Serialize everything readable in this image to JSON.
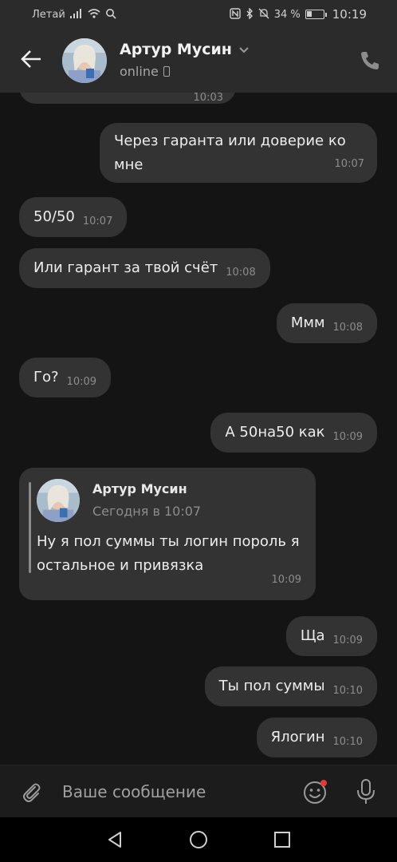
{
  "status_bar": {
    "carrier": "Летай",
    "battery": "34 %",
    "battery_level": 0.34,
    "time": "10:19"
  },
  "header": {
    "contact_name": "Артур Мусин",
    "presence": "online"
  },
  "messages": [
    {
      "text": "Через гаранта или доверие ко мне",
      "time": "10:07",
      "outgoing": true
    },
    {
      "text": "50/50",
      "time": "10:07",
      "outgoing": false
    },
    {
      "text": "Или гарант за твой счёт",
      "time": "10:08",
      "outgoing": false
    },
    {
      "text": "Ммм",
      "time": "10:08",
      "outgoing": true
    },
    {
      "text": "Го?",
      "time": "10:09",
      "outgoing": false
    },
    {
      "text": "А 50на50 как",
      "time": "10:09",
      "outgoing": true
    },
    {
      "reply_to": {
        "author": "Артур Мусин",
        "date": "Сегодня в 10:07"
      },
      "text": "Ну я пол суммы ты логин пороль я остальное и привязка",
      "time": "10:09",
      "outgoing": false
    },
    {
      "text": "Ща",
      "time": "10:09",
      "outgoing": true
    },
    {
      "text": "Ты пол суммы",
      "time": "10:10",
      "outgoing": true
    },
    {
      "text": "Ялогин",
      "time": "10:10",
      "outgoing": true
    }
  ],
  "partial_top_message_time": "10:03",
  "composer": {
    "placeholder": "Ваше сообщение"
  },
  "colors": {
    "bubble": "#333333",
    "background": "#141414",
    "header": "#2b2b2b",
    "notification_dot": "#e53935"
  }
}
